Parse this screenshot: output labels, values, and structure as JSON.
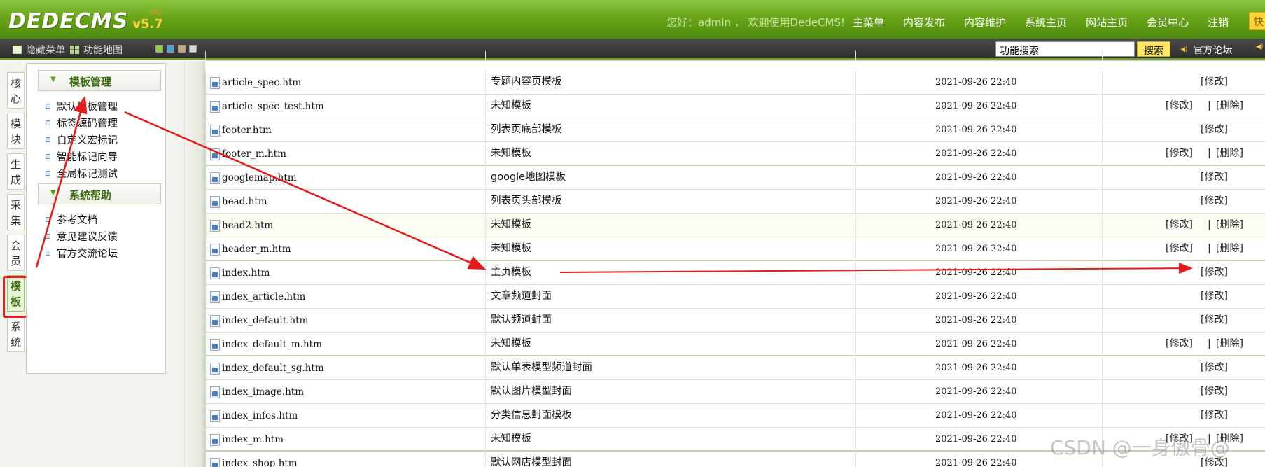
{
  "header": {
    "logo_text": "DEDECMS",
    "logo_version": "v5.7",
    "logo_edition": "SP2",
    "welcome": "您好：admin ， 欢迎使用DedeCMS!",
    "nav": [
      "主菜单",
      "内容发布",
      "内容维护",
      "系统主页",
      "网站主页",
      "会员中心",
      "注销"
    ],
    "quick_tab": "快"
  },
  "toolbar": {
    "hide_menu": "隐藏菜单",
    "function_map": "功能地图",
    "skin_colors": [
      "#8fd13c",
      "#4aa3e0",
      "#c8a878",
      "#d8d8d8"
    ],
    "search_value": "功能搜索",
    "search_button": "搜索",
    "forum": "官方论坛"
  },
  "vertical_tabs": [
    {
      "label": "核\n心",
      "active": false
    },
    {
      "label": "模\n块",
      "active": false
    },
    {
      "label": "生\n成",
      "active": false
    },
    {
      "label": "采\n集",
      "active": false
    },
    {
      "label": "会\n员",
      "active": false
    },
    {
      "label": "模\n板",
      "active": true
    },
    {
      "label": "系\n统",
      "active": false
    }
  ],
  "menu": {
    "section1_title": "模板管理",
    "section1_items": [
      "默认模板管理",
      "标签源码管理",
      "自定义宏标记",
      "智能标记向导",
      "全局标记测试"
    ],
    "section2_title": "系统帮助",
    "section2_items": [
      "参考文档",
      "意见建议反馈",
      "官方交流论坛"
    ]
  },
  "table": {
    "rows": [
      {
        "file": "article_spec.htm",
        "desc": "专题内容页模板",
        "date": "2021-09-26 22:40",
        "actions": [
          "[修改]"
        ]
      },
      {
        "file": "article_spec_test.htm",
        "desc": "未知模板",
        "date": "2021-09-26 22:40",
        "actions": [
          "[修改]",
          "[删除]"
        ]
      },
      {
        "file": "footer.htm",
        "desc": "列表页底部模板",
        "date": "2021-09-26 22:40",
        "actions": [
          "[修改]"
        ]
      },
      {
        "file": "footer_m.htm",
        "desc": "未知模板",
        "date": "2021-09-26 22:40",
        "actions": [
          "[修改]",
          "[删除]"
        ]
      },
      {
        "file": "googlemap.htm",
        "desc": "google地图模板",
        "date": "2021-09-26 22:40",
        "actions": [
          "[修改]"
        ]
      },
      {
        "file": "head.htm",
        "desc": "列表页头部模板",
        "date": "2021-09-26 22:40",
        "actions": [
          "[修改]"
        ]
      },
      {
        "file": "head2.htm",
        "desc": "未知模板",
        "date": "2021-09-26 22:40",
        "actions": [
          "[修改]",
          "[删除]"
        ]
      },
      {
        "file": "header_m.htm",
        "desc": "未知模板",
        "date": "2021-09-26 22:40",
        "actions": [
          "[修改]",
          "[删除]"
        ]
      },
      {
        "file": "index.htm",
        "desc": "主页模板",
        "date": "2021-09-26 22:40",
        "actions": [
          "[修改]"
        ]
      },
      {
        "file": "index_article.htm",
        "desc": "文章频道封面",
        "date": "2021-09-26 22:40",
        "actions": [
          "[修改]"
        ]
      },
      {
        "file": "index_default.htm",
        "desc": "默认频道封面",
        "date": "2021-09-26 22:40",
        "actions": [
          "[修改]"
        ]
      },
      {
        "file": "index_default_m.htm",
        "desc": "未知模板",
        "date": "2021-09-26 22:40",
        "actions": [
          "[修改]",
          "[删除]"
        ]
      },
      {
        "file": "index_default_sg.htm",
        "desc": "默认单表模型频道封面",
        "date": "2021-09-26 22:40",
        "actions": [
          "[修改]"
        ]
      },
      {
        "file": "index_image.htm",
        "desc": "默认图片模型封面",
        "date": "2021-09-26 22:40",
        "actions": [
          "[修改]"
        ]
      },
      {
        "file": "index_infos.htm",
        "desc": "分类信息封面模板",
        "date": "2021-09-26 22:40",
        "actions": [
          "[修改]"
        ]
      },
      {
        "file": "index_m.htm",
        "desc": "未知模板",
        "date": "2021-09-26 22:40",
        "actions": [
          "[修改]",
          "[删除]"
        ]
      },
      {
        "file": "index_shop.htm",
        "desc": "默认网店模型封面",
        "date": "2021-09-26 22:40",
        "actions": [
          "[修改]"
        ]
      }
    ]
  },
  "watermark": "CSDN @一身傲骨@",
  "annotation_color": "#e31b1b"
}
